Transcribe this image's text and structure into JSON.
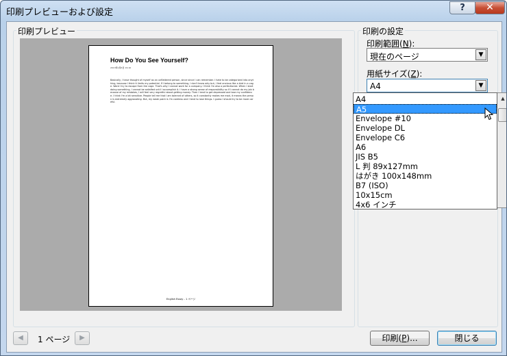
{
  "window": {
    "title": "印刷プレビューおよび設定"
  },
  "titlebar": {
    "help_label": "?",
    "close_label": "✕"
  },
  "preview": {
    "group_label": "印刷プレビュー",
    "doc_title": "How Do You See Yourself?",
    "doc_date": "2013年1月6日 19:16",
    "doc_body": "Basically, I have thought of myself as an unflattered person, since since I can remember. I hate to be categorized into anything, because I think it limits my potential. If I belong to something, I don't know why but, I feel anxious like a bird in a cage. Want I try to escape from the cage. That's why I cannot work for a company. I think I'm also a perfectionist. When I start doing something, I cannot be satisfied until I accomplish it. I have a strong sense of responsibility so if I cannot do my job because of my mistakes, I will feel very regretful about getting money. Then I tend to get depressed and lose my confidence. I think I'm a bit sensitive. People tell me that I am tolerant of others, so it constantly makes me mad, it means the person is extremely aggravating. But, my weak point is I'm careless and I tend to lose things. I guess I should try to be more careful.",
    "doc_footer": "English Essay - 1 ページ"
  },
  "settings": {
    "group_label": "印刷の設定",
    "range_label_prefix": "印刷範囲(",
    "range_label_key": "N",
    "range_label_suffix": "):",
    "range_value": "現在のページ",
    "paper_label_prefix": "用紙サイズ(",
    "paper_label_key": "Z",
    "paper_label_suffix": "):",
    "paper_value": "A4",
    "paper_options": [
      "A4",
      "A5",
      "Envelope #10",
      "Envelope DL",
      "Envelope C6",
      "A6",
      "JIS B5",
      "L 判 89x127mm",
      "はがき 100x148mm",
      "B7 (ISO)",
      "10x15cm",
      "4x6 インチ"
    ],
    "highlighted_option": "A5"
  },
  "footer": {
    "prev_label": "◀",
    "next_label": "▶",
    "page_count": "1 ページ",
    "print_prefix": "印刷(",
    "print_key": "P",
    "print_suffix": ")...",
    "close_label": "閉じる"
  },
  "icons": [
    "help-icon",
    "close-icon",
    "chevron-down-icon",
    "scroll-up-arrow-icon",
    "mouse-cursor-icon",
    "prev-page-icon",
    "next-page-icon"
  ]
}
